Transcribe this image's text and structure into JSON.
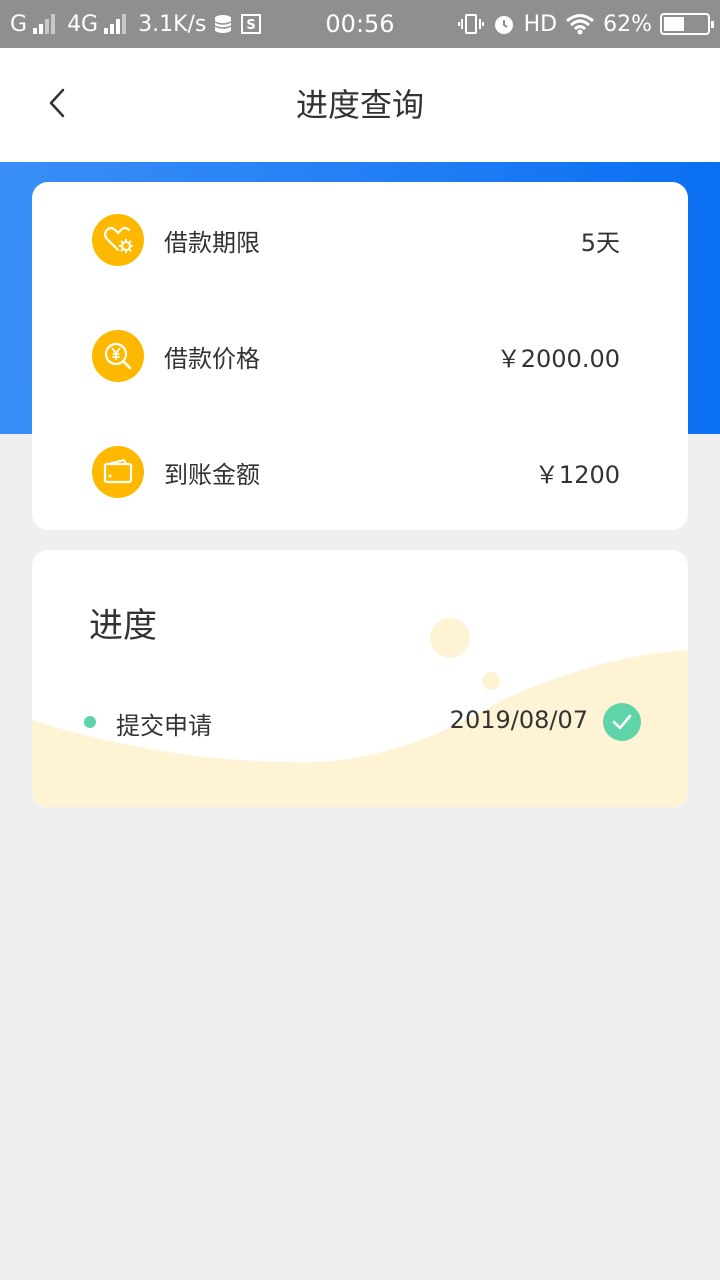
{
  "status_bar": {
    "carrier1": "G",
    "carrier2": "4G",
    "speed": "3.1K/s",
    "time": "00:56",
    "hd": "HD",
    "battery": "62%"
  },
  "header": {
    "title": "进度查询",
    "back_icon": "chevron-left-icon"
  },
  "colors": {
    "primary_blue": "#1f7cf4",
    "accent_yellow": "#ffb800",
    "success_green": "#5ed4a8",
    "wave_fill": "#fff3d6"
  },
  "loan_info": {
    "items": [
      {
        "icon": "heart-gear-icon",
        "label": "借款期限",
        "value": "5天"
      },
      {
        "icon": "yuan-search-icon",
        "label": "借款价格",
        "value": "￥2000.00"
      },
      {
        "icon": "wallet-icon",
        "label": "到账金额",
        "value": "￥1200"
      }
    ]
  },
  "progress": {
    "title": "进度",
    "steps": [
      {
        "label": "提交申请",
        "date": "2019/08/07",
        "status": "done",
        "icon": "check-circle-icon"
      }
    ]
  }
}
